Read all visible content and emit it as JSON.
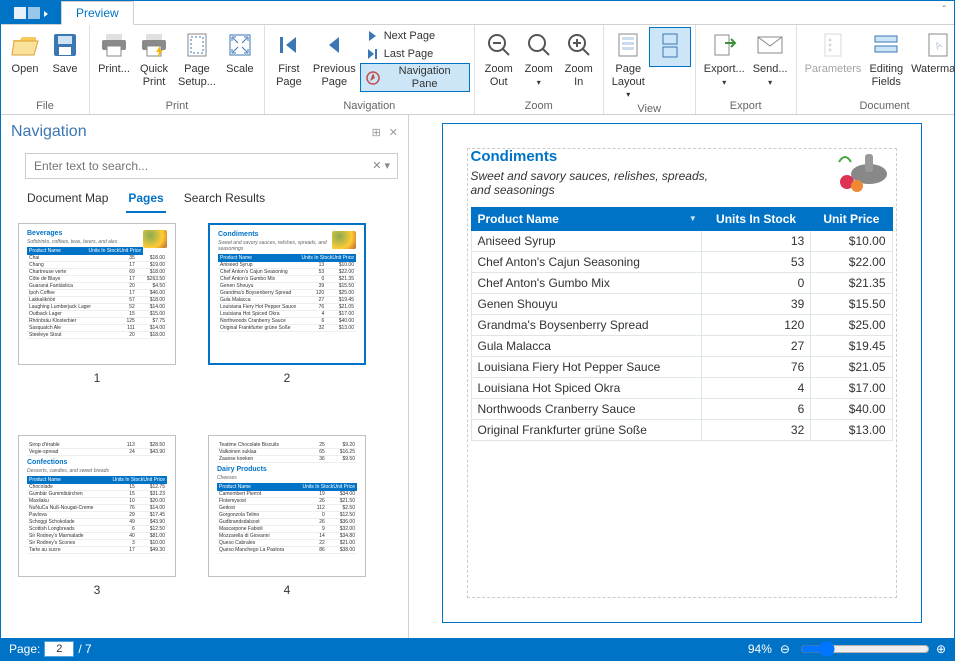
{
  "tabs": {
    "preview": "Preview"
  },
  "ribbon": {
    "file": {
      "label": "File",
      "open": "Open",
      "save": "Save"
    },
    "print": {
      "label": "Print",
      "print": "Print...",
      "quick": "Quick\nPrint",
      "setup": "Page\nSetup...",
      "scale": "Scale"
    },
    "nav": {
      "label": "Navigation",
      "first": "First\nPage",
      "prev": "Previous\nPage",
      "next": "Next Page",
      "last": "Last Page",
      "pane": "Navigation Pane"
    },
    "zoom": {
      "label": "Zoom",
      "out": "Zoom\nOut",
      "zoom": "Zoom",
      "in": "Zoom\nIn"
    },
    "view": {
      "label": "View",
      "layout": "Page\nLayout"
    },
    "export": {
      "label": "Export",
      "export": "Export...",
      "send": "Send..."
    },
    "document": {
      "label": "Document",
      "params": "Parameters",
      "fields": "Editing\nFields",
      "watermark": "Watermark"
    }
  },
  "navPanel": {
    "title": "Navigation",
    "searchPlaceholder": "Enter text to search...",
    "tabs": {
      "map": "Document Map",
      "pages": "Pages",
      "results": "Search Results"
    },
    "thumbs": [
      {
        "num": "1",
        "title": "Beverages",
        "sub": "Softdrinks, coffees, teas, beers, and ales",
        "rows": [
          [
            "Chai",
            "35",
            "$18.00"
          ],
          [
            "Chang",
            "17",
            "$19.00"
          ],
          [
            "Chartreuse verte",
            "69",
            "$18.00"
          ],
          [
            "Côte de Blaye",
            "17",
            "$263.50"
          ],
          [
            "Guaraná Fantástica",
            "20",
            "$4.50"
          ],
          [
            "Ipoh Coffee",
            "17",
            "$46.00"
          ],
          [
            "Lakkalikööri",
            "57",
            "$18.00"
          ],
          [
            "Laughing Lumberjack Lager",
            "52",
            "$14.00"
          ],
          [
            "Outback Lager",
            "15",
            "$15.00"
          ],
          [
            "Rhönbräu Klosterbier",
            "125",
            "$7.75"
          ],
          [
            "Sasquatch Ale",
            "111",
            "$14.00"
          ],
          [
            "Steeleye Stout",
            "20",
            "$18.00"
          ]
        ]
      },
      {
        "num": "2",
        "title": "Condiments",
        "sub": "Sweet and savory sauces, relishes, spreads, and seasonings",
        "rows": [
          [
            "Aniseed Syrup",
            "13",
            "$10.00"
          ],
          [
            "Chef Anton's Cajun Seasoning",
            "53",
            "$22.00"
          ],
          [
            "Chef Anton's Gumbo Mix",
            "0",
            "$21.35"
          ],
          [
            "Genen Shouyu",
            "39",
            "$15.50"
          ],
          [
            "Grandma's Boysenberry Spread",
            "120",
            "$25.00"
          ],
          [
            "Gula Malacca",
            "27",
            "$19.45"
          ],
          [
            "Louisiana Fiery Hot Pepper Sauce",
            "76",
            "$21.05"
          ],
          [
            "Louisiana Hot Spiced Okra",
            "4",
            "$17.00"
          ],
          [
            "Northwoods Cranberry Sauce",
            "6",
            "$40.00"
          ],
          [
            "Original Frankfurter grüne Soße",
            "32",
            "$13.00"
          ]
        ]
      },
      {
        "num": "3",
        "title": "Confections",
        "sub": "Desserts, candies, and sweet breads",
        "rows_top": [
          [
            "Sirop d'érable",
            "113",
            "$28.50"
          ],
          [
            "Vegie-spread",
            "24",
            "$43.90"
          ]
        ],
        "rows": [
          [
            "Chocolade",
            "15",
            "$12.75"
          ],
          [
            "Gumbär Gummibärchen",
            "15",
            "$31.23"
          ],
          [
            "Maxilaku",
            "10",
            "$20.00"
          ],
          [
            "NuNuCa Nuß-Nougat-Creme",
            "76",
            "$14.00"
          ],
          [
            "Pavlova",
            "29",
            "$17.45"
          ],
          [
            "Schoggi Schokolade",
            "49",
            "$43.90"
          ],
          [
            "Scottish Longbreads",
            "6",
            "$12.50"
          ],
          [
            "Sir Rodney's Marmalade",
            "40",
            "$81.00"
          ],
          [
            "Sir Rodney's Scones",
            "3",
            "$10.00"
          ],
          [
            "Tarte au sucre",
            "17",
            "$49.30"
          ]
        ]
      },
      {
        "num": "4",
        "title": "Dairy Products",
        "sub": "Cheeses",
        "rows_top": [
          [
            "Teatime Chocolate Biscuits",
            "25",
            "$9.20"
          ],
          [
            "Valkoinen suklaa",
            "65",
            "$16.25"
          ],
          [
            "Zaanse koeken",
            "36",
            "$9.50"
          ]
        ],
        "rows": [
          [
            "Camembert Pierrot",
            "19",
            "$34.00"
          ],
          [
            "Flotemysost",
            "26",
            "$21.50"
          ],
          [
            "Geitost",
            "112",
            "$2.50"
          ],
          [
            "Gorgonzola Telino",
            "0",
            "$12.50"
          ],
          [
            "Gudbrandsdalsost",
            "26",
            "$36.00"
          ],
          [
            "Mascarpone Fabioli",
            "9",
            "$32.00"
          ],
          [
            "Mozzarella di Giovanni",
            "14",
            "$34.80"
          ],
          [
            "Queso Cabrales",
            "22",
            "$21.00"
          ],
          [
            "Queso Manchego La Pastora",
            "86",
            "$38.00"
          ]
        ]
      }
    ]
  },
  "preview": {
    "category": "Condiments",
    "subtitle": "Sweet and savory sauces, relishes, spreads, and seasonings",
    "columns": [
      "Product Name",
      "Units In Stock",
      "Unit Price"
    ],
    "rows": [
      {
        "name": "Aniseed Syrup",
        "stock": "13",
        "price": "$10.00"
      },
      {
        "name": "Chef Anton's Cajun Seasoning",
        "stock": "53",
        "price": "$22.00"
      },
      {
        "name": "Chef Anton's Gumbo Mix",
        "stock": "0",
        "price": "$21.35"
      },
      {
        "name": "Genen Shouyu",
        "stock": "39",
        "price": "$15.50"
      },
      {
        "name": "Grandma's Boysenberry Spread",
        "stock": "120",
        "price": "$25.00"
      },
      {
        "name": "Gula Malacca",
        "stock": "27",
        "price": "$19.45"
      },
      {
        "name": "Louisiana Fiery Hot Pepper Sauce",
        "stock": "76",
        "price": "$21.05"
      },
      {
        "name": "Louisiana Hot Spiced Okra",
        "stock": "4",
        "price": "$17.00"
      },
      {
        "name": "Northwoods Cranberry Sauce",
        "stock": "6",
        "price": "$40.00"
      },
      {
        "name": "Original Frankfurter grüne Soße",
        "stock": "32",
        "price": "$13.00"
      }
    ]
  },
  "status": {
    "pageLabel": "Page:",
    "current": "2",
    "total": "/ 7",
    "zoom": "94%"
  }
}
